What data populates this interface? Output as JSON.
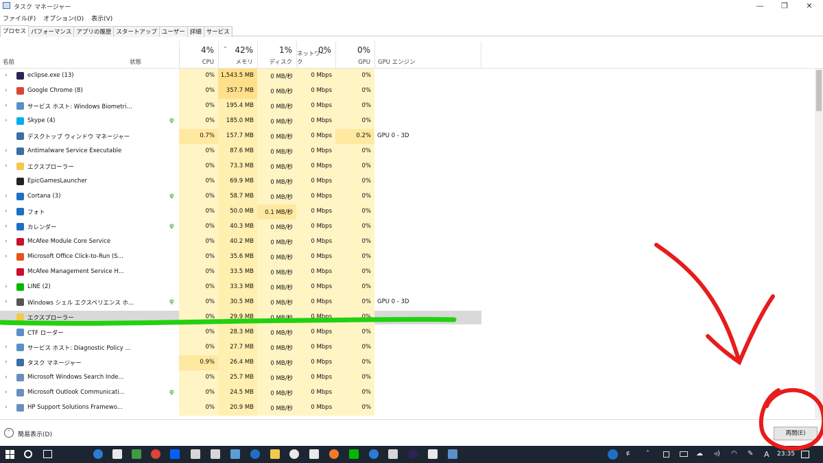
{
  "window": {
    "title": "タスク マネージャー",
    "minimize": "—",
    "maximize": "❐",
    "close": "✕"
  },
  "menu": [
    "ファイル(F)",
    "オプション(O)",
    "表示(V)"
  ],
  "tabs": [
    "プロセス",
    "パフォーマンス",
    "アプリの履歴",
    "スタートアップ",
    "ユーザー",
    "詳細",
    "サービス"
  ],
  "columns": {
    "name": "名前",
    "status": "状態",
    "cpu": {
      "pct": "4%",
      "label": "CPU"
    },
    "memory": {
      "pct": "42%",
      "label": "メモリ"
    },
    "disk": {
      "pct": "1%",
      "label": "ディスク"
    },
    "network": {
      "pct": "0%",
      "label": "ネットワーク"
    },
    "gpu": {
      "pct": "0%",
      "label": "GPU"
    },
    "gpu_engine": "GPU エンジン"
  },
  "processes": [
    {
      "expand": "›",
      "name": "eclipse.exe (13)",
      "cpu": "0%",
      "mem": "1,543.5 MB",
      "disk": "0 MB/秒",
      "net": "0 Mbps",
      "gpu": "0%",
      "engine": "",
      "icon": "#2c2255",
      "leaf": ""
    },
    {
      "expand": "›",
      "name": "Google Chrome (8)",
      "cpu": "0%",
      "mem": "357.7 MB",
      "disk": "0 MB/秒",
      "net": "0 Mbps",
      "gpu": "0%",
      "engine": "",
      "icon": "#db4437",
      "leaf": ""
    },
    {
      "expand": "›",
      "name": "サービス ホスト: Windows Biometri...",
      "cpu": "0%",
      "mem": "195.4 MB",
      "disk": "0 MB/秒",
      "net": "0 Mbps",
      "gpu": "0%",
      "engine": "",
      "icon": "#5b8fc7",
      "leaf": ""
    },
    {
      "expand": "›",
      "name": "Skype (4)",
      "cpu": "0%",
      "mem": "185.0 MB",
      "disk": "0 MB/秒",
      "net": "0 Mbps",
      "gpu": "0%",
      "engine": "",
      "icon": "#00aff0",
      "leaf": "φ"
    },
    {
      "expand": "",
      "name": "デスクトップ ウィンドウ マネージャー",
      "cpu": "0.7%",
      "mem": "157.7 MB",
      "disk": "0 MB/秒",
      "net": "0 Mbps",
      "gpu": "0.2%",
      "engine": "GPU 0 - 3D",
      "icon": "#3a6ea5",
      "leaf": ""
    },
    {
      "expand": "›",
      "name": "Antimalware Service Executable",
      "cpu": "0%",
      "mem": "87.6 MB",
      "disk": "0 MB/秒",
      "net": "0 Mbps",
      "gpu": "0%",
      "engine": "",
      "icon": "#3a6ea5",
      "leaf": ""
    },
    {
      "expand": "›",
      "name": "エクスプローラー",
      "cpu": "0%",
      "mem": "73.3 MB",
      "disk": "0 MB/秒",
      "net": "0 Mbps",
      "gpu": "0%",
      "engine": "",
      "icon": "#f2c94c",
      "leaf": ""
    },
    {
      "expand": "",
      "name": "EpicGamesLauncher",
      "cpu": "0%",
      "mem": "69.9 MB",
      "disk": "0 MB/秒",
      "net": "0 Mbps",
      "gpu": "0%",
      "engine": "",
      "icon": "#222222",
      "leaf": ""
    },
    {
      "expand": "›",
      "name": "Cortana (3)",
      "cpu": "0%",
      "mem": "58.7 MB",
      "disk": "0 MB/秒",
      "net": "0 Mbps",
      "gpu": "0%",
      "engine": "",
      "icon": "#1f6fc5",
      "leaf": "φ"
    },
    {
      "expand": "›",
      "name": "フォト",
      "cpu": "0%",
      "mem": "50.0 MB",
      "disk": "0.1 MB/秒",
      "net": "0 Mbps",
      "gpu": "0%",
      "engine": "",
      "icon": "#1f6fc5",
      "leaf": ""
    },
    {
      "expand": "›",
      "name": "カレンダー",
      "cpu": "0%",
      "mem": "40.3 MB",
      "disk": "0 MB/秒",
      "net": "0 Mbps",
      "gpu": "0%",
      "engine": "",
      "icon": "#1f6fc5",
      "leaf": "φ"
    },
    {
      "expand": "›",
      "name": "McAfee Module Core Service",
      "cpu": "0%",
      "mem": "40.2 MB",
      "disk": "0 MB/秒",
      "net": "0 Mbps",
      "gpu": "0%",
      "engine": "",
      "icon": "#c8102e",
      "leaf": ""
    },
    {
      "expand": "›",
      "name": "Microsoft Office Click-to-Run (S...",
      "cpu": "0%",
      "mem": "35.6 MB",
      "disk": "0 MB/秒",
      "net": "0 Mbps",
      "gpu": "0%",
      "engine": "",
      "icon": "#e5531a",
      "leaf": ""
    },
    {
      "expand": "",
      "name": "McAfee Management Service H...",
      "cpu": "0%",
      "mem": "33.5 MB",
      "disk": "0 MB/秒",
      "net": "0 Mbps",
      "gpu": "0%",
      "engine": "",
      "icon": "#c8102e",
      "leaf": ""
    },
    {
      "expand": "›",
      "name": "LINE (2)",
      "cpu": "0%",
      "mem": "33.3 MB",
      "disk": "0 MB/秒",
      "net": "0 Mbps",
      "gpu": "0%",
      "engine": "",
      "icon": "#00b900",
      "leaf": ""
    },
    {
      "expand": "›",
      "name": "Windows シェル エクスペリエンス ホ...",
      "cpu": "0%",
      "mem": "30.5 MB",
      "disk": "0 MB/秒",
      "net": "0 Mbps",
      "gpu": "0%",
      "engine": "GPU 0 - 3D",
      "icon": "#555555",
      "leaf": "φ"
    },
    {
      "expand": "",
      "name": "エクスプローラー",
      "cpu": "0%",
      "mem": "29.9 MB",
      "disk": "0 MB/秒",
      "net": "0 Mbps",
      "gpu": "0%",
      "engine": "",
      "icon": "#f2c94c",
      "leaf": "",
      "selected": true
    },
    {
      "expand": "",
      "name": "CTF ローダー",
      "cpu": "0%",
      "mem": "28.3 MB",
      "disk": "0 MB/秒",
      "net": "0 Mbps",
      "gpu": "0%",
      "engine": "",
      "icon": "#5b8fc7",
      "leaf": ""
    },
    {
      "expand": "›",
      "name": "サービス ホスト: Diagnostic Policy ...",
      "cpu": "0%",
      "mem": "27.7 MB",
      "disk": "0 MB/秒",
      "net": "0 Mbps",
      "gpu": "0%",
      "engine": "",
      "icon": "#5b8fc7",
      "leaf": ""
    },
    {
      "expand": "›",
      "name": "タスク マネージャー",
      "cpu": "0.9%",
      "mem": "26.4 MB",
      "disk": "0 MB/秒",
      "net": "0 Mbps",
      "gpu": "0%",
      "engine": "",
      "icon": "#3a6ea5",
      "leaf": ""
    },
    {
      "expand": "›",
      "name": "Microsoft Windows Search Inde...",
      "cpu": "0%",
      "mem": "25.7 MB",
      "disk": "0 MB/秒",
      "net": "0 Mbps",
      "gpu": "0%",
      "engine": "",
      "icon": "#6a8fbf",
      "leaf": ""
    },
    {
      "expand": "›",
      "name": "Microsoft Outlook Communicati...",
      "cpu": "0%",
      "mem": "24.5 MB",
      "disk": "0 MB/秒",
      "net": "0 Mbps",
      "gpu": "0%",
      "engine": "",
      "icon": "#6a8fbf",
      "leaf": "φ"
    },
    {
      "expand": "›",
      "name": "HP Support Solutions Framewo...",
      "cpu": "0%",
      "mem": "20.9 MB",
      "disk": "0 MB/秒",
      "net": "0 Mbps",
      "gpu": "0%",
      "engine": "",
      "icon": "#6a8fbf",
      "leaf": ""
    }
  ],
  "footer": {
    "fewer_details": "簡易表示(D)",
    "resume": "再開(E)"
  },
  "taskbar": {
    "clock": "23:35",
    "ime": "A"
  },
  "colors": {
    "annotation_red": "#e81c1c",
    "annotation_green": "#22d10f"
  }
}
